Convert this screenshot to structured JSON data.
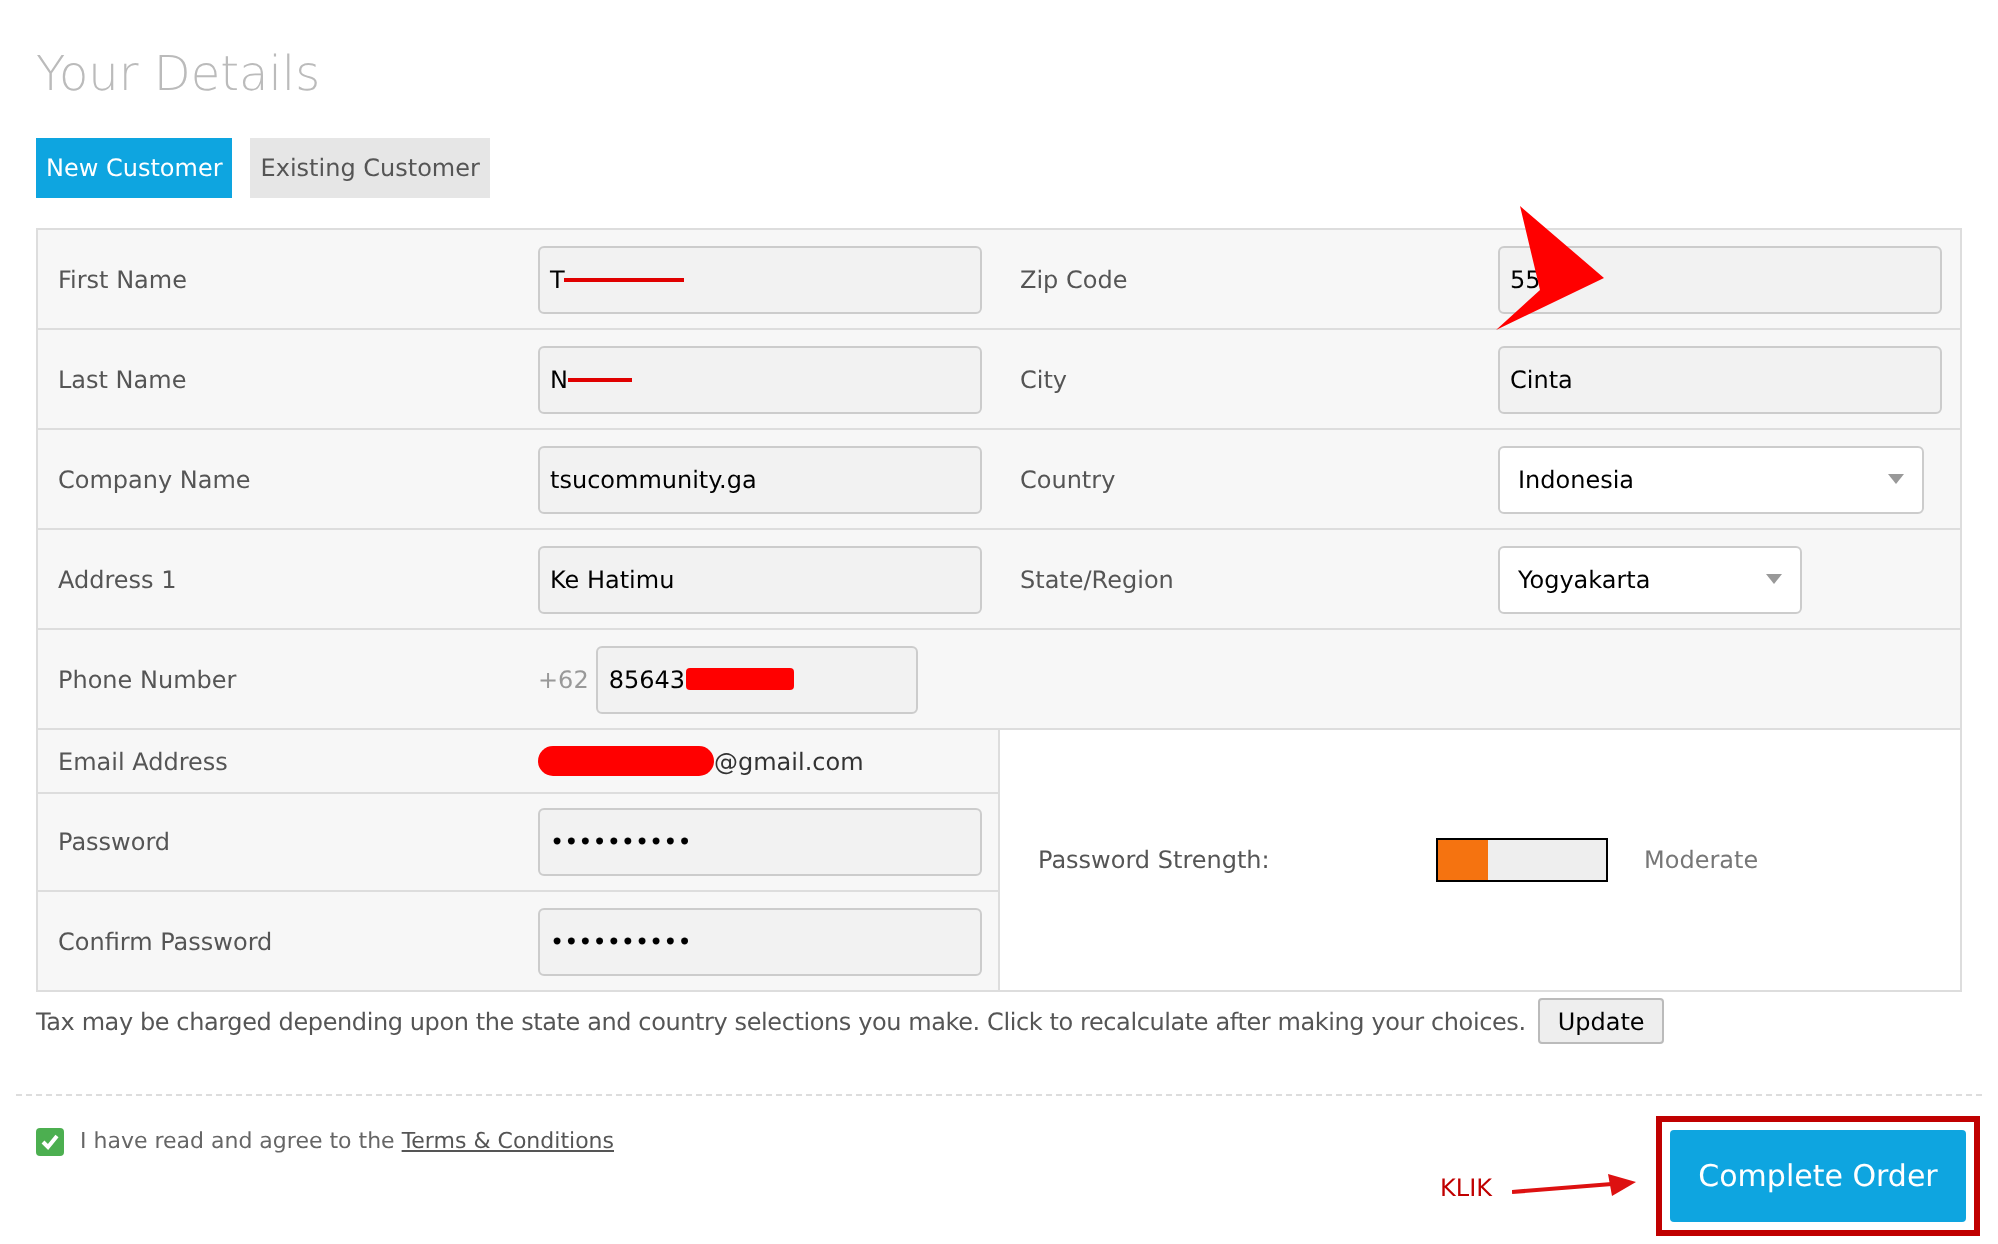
{
  "title": "Your Details",
  "tabs": [
    {
      "label": "New Customer",
      "selected": true
    },
    {
      "label": "Existing Customer",
      "selected": false
    }
  ],
  "rows": [
    {
      "left": {
        "label": "First Name",
        "kind": "text",
        "value": "T",
        "redacted": true
      },
      "right": {
        "label": "Zip Code",
        "kind": "text",
        "value": "55"
      }
    },
    {
      "left": {
        "label": "Last Name",
        "kind": "text",
        "value": "N",
        "redacted": true
      },
      "right": {
        "label": "City",
        "kind": "text",
        "value": "Cinta"
      }
    },
    {
      "left": {
        "label": "Company Name",
        "kind": "text",
        "value": "tsucommunity.ga"
      },
      "right": {
        "label": "Country",
        "kind": "select",
        "value": "Indonesia"
      }
    },
    {
      "left": {
        "label": "Address 1",
        "kind": "text",
        "value": "Ke Hatimu"
      },
      "right": {
        "label": "State/Region",
        "kind": "select",
        "value": "Yogyakarta"
      }
    },
    {
      "left": {
        "label": "Phone Number",
        "kind": "phone",
        "prefix": "+62",
        "value": "85643",
        "redacted": true
      }
    }
  ],
  "account": [
    {
      "label": "Email Address",
      "kind": "plain",
      "value": "@gmail.com",
      "redacted": true
    },
    {
      "label": "Password",
      "kind": "text",
      "value": "••••••••••"
    },
    {
      "label": "Confirm Password",
      "kind": "text",
      "value": "••••••••••"
    }
  ],
  "strength": {
    "label": "Password Strength:",
    "level": 0.3,
    "reading": "Moderate"
  },
  "tax_note": "Tax may be charged depending upon the state and country selections you make. Click to recalculate after making your choices.",
  "update_button": "Update",
  "agree": {
    "checked": true,
    "text": "I have read and agree to the",
    "link": "Terms & Conditions"
  },
  "annotation": {
    "label": "KLIK"
  },
  "complete_button": "Complete Order"
}
